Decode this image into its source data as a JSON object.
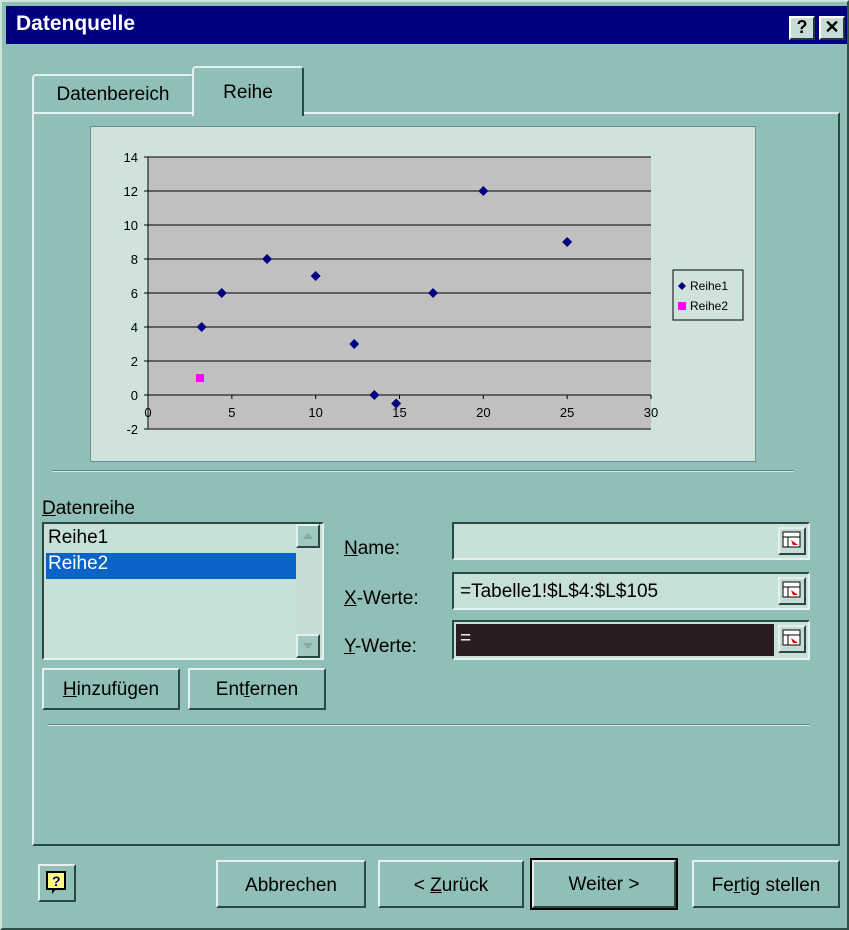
{
  "window": {
    "title": "Datenquelle",
    "help_glyph": "?",
    "close_glyph": "✕"
  },
  "tabs": [
    {
      "label": "Datenbereich",
      "active": false
    },
    {
      "label": "Reihe",
      "active": true
    }
  ],
  "chart_data": {
    "type": "scatter",
    "xlim": [
      0,
      30
    ],
    "ylim": [
      -2,
      14
    ],
    "x_ticks": [
      "0",
      "5",
      "10",
      "15",
      "20",
      "25",
      "30"
    ],
    "y_ticks": [
      "14",
      "12",
      "10",
      "8",
      "6",
      "4",
      "2",
      "0",
      "-2"
    ],
    "grid": "horizontal",
    "legend_position": "right",
    "series": [
      {
        "name": "Reihe1",
        "color": "#000080",
        "marker": "diamond",
        "points": [
          [
            3.2,
            4
          ],
          [
            4.4,
            6
          ],
          [
            7.1,
            8
          ],
          [
            10,
            7
          ],
          [
            12.3,
            3
          ],
          [
            13.5,
            0
          ],
          [
            14.8,
            -0.5
          ],
          [
            17,
            6
          ],
          [
            20,
            12
          ],
          [
            25,
            9
          ]
        ]
      },
      {
        "name": "Reihe2",
        "color": "#ff00ff",
        "marker": "square",
        "points": [
          [
            3.1,
            1
          ]
        ]
      }
    ]
  },
  "series_section": {
    "label_pre": "",
    "label_mnemonic": "D",
    "label_post": "atenreihe",
    "items": [
      {
        "label": "Reihe1",
        "selected": false
      },
      {
        "label": "Reihe2",
        "selected": true
      }
    ]
  },
  "fields": {
    "name": {
      "label_mnemonic": "N",
      "label_post": "ame:",
      "value": ""
    },
    "x": {
      "label_mnemonic": "X",
      "label_post": "-Werte:",
      "value": "=Tabelle1!$L$4:$L$105"
    },
    "y": {
      "label_mnemonic": "Y",
      "label_post": "-Werte:",
      "value": "="
    }
  },
  "buttons": {
    "add": {
      "pre": "",
      "mn": "H",
      "post": "inzufügen"
    },
    "remove": {
      "pre": "Ent",
      "mn": "f",
      "post": "ernen"
    },
    "cancel": {
      "label": "Abbrechen"
    },
    "back": {
      "pre": "< ",
      "mn": "Z",
      "post": "urück"
    },
    "next": {
      "label": "Weiter >"
    },
    "finish": {
      "pre": "Fe",
      "mn": "r",
      "post": "tig stellen"
    }
  },
  "colors": {
    "dialog": "#8fbfb6",
    "title_bar": "#000080",
    "selection": "#0a64c8",
    "plot_area": "#c0c0c0",
    "y_field": "#2b1d1f"
  }
}
